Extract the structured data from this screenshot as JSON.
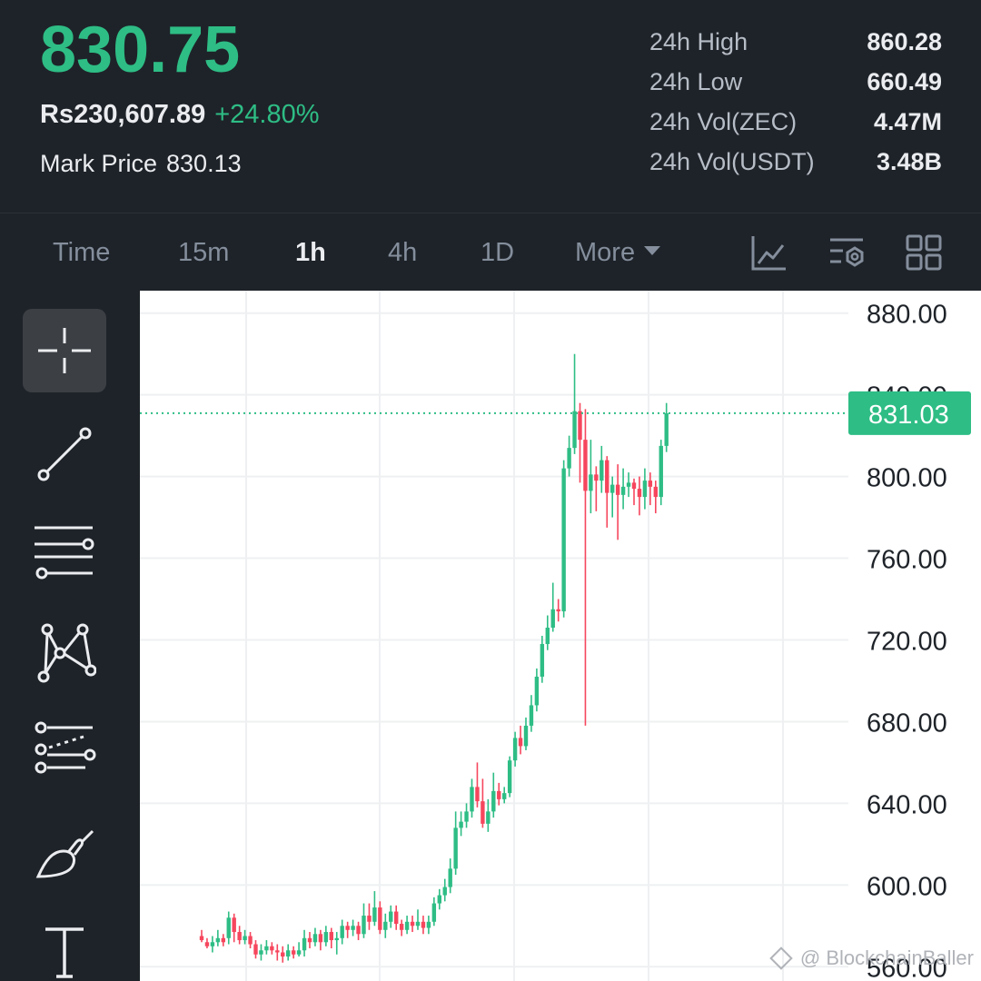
{
  "header": {
    "last_price": "830.75",
    "fiat_price": "Rs230,607.89",
    "change_pct": "+24.80%",
    "mark_label": "Mark Price",
    "mark_value": "830.13",
    "stats": [
      {
        "label": "24h High",
        "value": "860.28"
      },
      {
        "label": "24h Low",
        "value": "660.49"
      },
      {
        "label": "24h Vol(ZEC)",
        "value": "4.47M"
      },
      {
        "label": "24h Vol(USDT)",
        "value": "3.48B"
      }
    ]
  },
  "timeframes": [
    {
      "label": "Time",
      "active": false
    },
    {
      "label": "15m",
      "active": false
    },
    {
      "label": "1h",
      "active": true
    },
    {
      "label": "4h",
      "active": false
    },
    {
      "label": "1D",
      "active": false
    },
    {
      "label": "More",
      "active": false
    }
  ],
  "toolbar_icons": [
    "chart-indicator-icon",
    "chart-settings-icon",
    "grid-layout-icon"
  ],
  "drawing_tools": [
    {
      "name": "crosshair-icon",
      "active": true
    },
    {
      "name": "trend-line-icon",
      "active": false
    },
    {
      "name": "horizontal-lines-icon",
      "active": false
    },
    {
      "name": "pattern-icon",
      "active": false
    },
    {
      "name": "fib-lines-icon",
      "active": false
    },
    {
      "name": "brush-icon",
      "active": false
    },
    {
      "name": "text-icon",
      "active": false
    }
  ],
  "colors": {
    "up": "#2ebd85",
    "down": "#f6465d",
    "background": "#1e2329"
  },
  "chart_data": {
    "type": "candlestick",
    "y_ticks": [
      "880.00",
      "840.00",
      "800.00",
      "760.00",
      "720.00",
      "680.00",
      "640.00",
      "600.00",
      "560.00"
    ],
    "ylim": [
      553,
      891
    ],
    "current_price_label": "831.03",
    "current_price": 831.03,
    "candles": [
      [
        575,
        573,
        578,
        572
      ],
      [
        572,
        570,
        574,
        569
      ],
      [
        570,
        572,
        575,
        567
      ],
      [
        572,
        574,
        578,
        570
      ],
      [
        574,
        572,
        576,
        570
      ],
      [
        574,
        584,
        587,
        571
      ],
      [
        584,
        577,
        586,
        572
      ],
      [
        577,
        573,
        580,
        571
      ],
      [
        573,
        575,
        578,
        571
      ],
      [
        575,
        571,
        577,
        569
      ],
      [
        571,
        566,
        573,
        564
      ],
      [
        566,
        568,
        571,
        563
      ],
      [
        568,
        570,
        573,
        566
      ],
      [
        570,
        568,
        572,
        566
      ],
      [
        568,
        567,
        571,
        563
      ],
      [
        567,
        565,
        570,
        562
      ],
      [
        565,
        568,
        571,
        563
      ],
      [
        568,
        566,
        570,
        564
      ],
      [
        566,
        568,
        572,
        565
      ],
      [
        568,
        574,
        578,
        565
      ],
      [
        574,
        572,
        577,
        569
      ],
      [
        572,
        576,
        579,
        570
      ],
      [
        576,
        572,
        578,
        568
      ],
      [
        572,
        577,
        580,
        570
      ],
      [
        577,
        573,
        579,
        569
      ],
      [
        573,
        574,
        577,
        566
      ],
      [
        574,
        580,
        583,
        571
      ],
      [
        580,
        578,
        582,
        574
      ],
      [
        578,
        580,
        583,
        575
      ],
      [
        580,
        576,
        582,
        573
      ],
      [
        576,
        585,
        591,
        574
      ],
      [
        585,
        582,
        591,
        578
      ],
      [
        582,
        589,
        597,
        580
      ],
      [
        589,
        578,
        592,
        576
      ],
      [
        578,
        582,
        586,
        574
      ],
      [
        582,
        587,
        590,
        579
      ],
      [
        587,
        581,
        590,
        578
      ],
      [
        581,
        578,
        583,
        575
      ],
      [
        578,
        582,
        585,
        576
      ],
      [
        582,
        580,
        585,
        577
      ],
      [
        580,
        582,
        588,
        578
      ],
      [
        582,
        579,
        585,
        576
      ],
      [
        579,
        582,
        585,
        576
      ],
      [
        582,
        591,
        594,
        580
      ],
      [
        591,
        595,
        598,
        588
      ],
      [
        595,
        599,
        603,
        592
      ],
      [
        599,
        608,
        613,
        596
      ],
      [
        608,
        628,
        636,
        605
      ],
      [
        628,
        631,
        636,
        624
      ],
      [
        631,
        636,
        640,
        628
      ],
      [
        636,
        648,
        652,
        633
      ],
      [
        648,
        641,
        660,
        638
      ],
      [
        641,
        630,
        652,
        628
      ],
      [
        630,
        636,
        642,
        626
      ],
      [
        636,
        646,
        655,
        633
      ],
      [
        646,
        642,
        650,
        639
      ],
      [
        642,
        645,
        648,
        640
      ],
      [
        645,
        661,
        663,
        643
      ],
      [
        661,
        672,
        675,
        658
      ],
      [
        672,
        668,
        678,
        664
      ],
      [
        668,
        678,
        682,
        666
      ],
      [
        678,
        688,
        693,
        675
      ],
      [
        688,
        702,
        706,
        685
      ],
      [
        702,
        718,
        722,
        699
      ],
      [
        718,
        726,
        732,
        715
      ],
      [
        726,
        735,
        748,
        724
      ],
      [
        735,
        734,
        740,
        729
      ],
      [
        734,
        804,
        808,
        731
      ],
      [
        804,
        814,
        820,
        800
      ],
      [
        814,
        832,
        860,
        811
      ],
      [
        832,
        818,
        836,
        797
      ],
      [
        818,
        793,
        833,
        678
      ],
      [
        793,
        801,
        818,
        782
      ],
      [
        801,
        798,
        805,
        783
      ],
      [
        798,
        808,
        815,
        792
      ],
      [
        808,
        792,
        810,
        775
      ],
      [
        792,
        796,
        800,
        780
      ],
      [
        796,
        791,
        806,
        769
      ],
      [
        791,
        795,
        804,
        784
      ],
      [
        795,
        797,
        802,
        790
      ],
      [
        797,
        794,
        799,
        786
      ],
      [
        794,
        790,
        800,
        781
      ],
      [
        790,
        798,
        804,
        784
      ],
      [
        798,
        795,
        802,
        786
      ],
      [
        795,
        790,
        798,
        782
      ],
      [
        790,
        815,
        818,
        786
      ],
      [
        815,
        831,
        836,
        812
      ]
    ]
  },
  "watermark": "@ BlockchainBaller"
}
